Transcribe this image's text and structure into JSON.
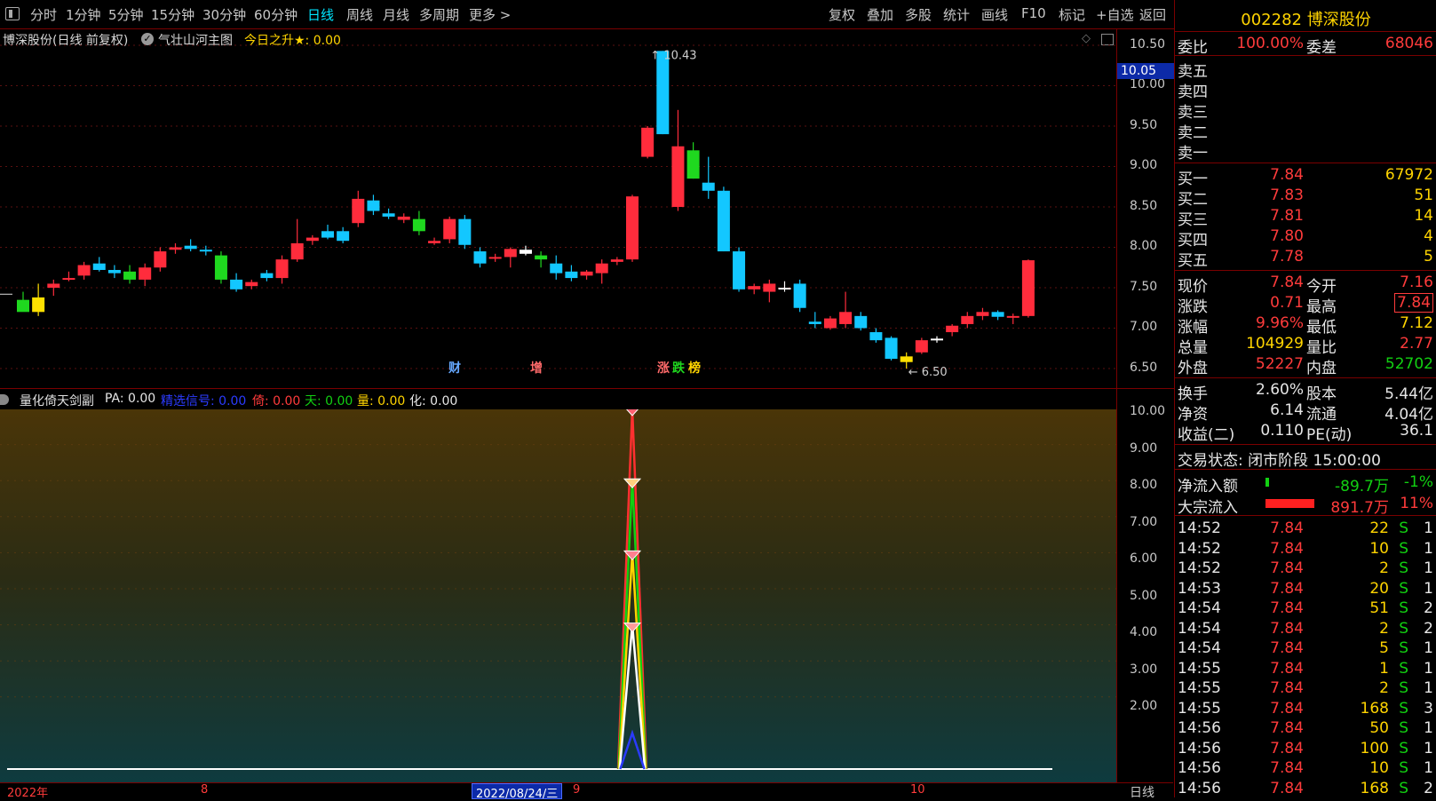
{
  "toolbar": {
    "menu_icon": "menu-icon",
    "periods": [
      "分时",
      "1分钟",
      "5分钟",
      "15分钟",
      "30分钟",
      "60分钟",
      "日线",
      "周线",
      "月线",
      "多周期",
      "更多 >"
    ],
    "active_period": "日线",
    "actions": [
      "复权",
      "叠加",
      "多股",
      "统计",
      "画线",
      "F10",
      "标记",
      "+自选",
      "返回"
    ]
  },
  "main_chart": {
    "title": "博深股份(日线 前复权)",
    "indicator": "气壮山河主图",
    "rise_label": "今日之升★: 0.00",
    "price_high": "10.43",
    "price_low": "← 6.50",
    "current_price_tag": "10.05",
    "y_axis": [
      "10.50",
      "10.00",
      "9.50",
      "9.00",
      "8.50",
      "8.00",
      "7.50",
      "7.00",
      "6.50"
    ],
    "markers": {
      "cai": "财",
      "zeng": "增",
      "zhang": "涨",
      "die": "跌",
      "bang": "榜"
    },
    "colors": {
      "up": "#ff2c3c",
      "down": "#13c7ff",
      "flat": "#ffffff",
      "green": "#1fd81f",
      "yellow": "#ffe000"
    },
    "candles": [
      {
        "o": 7.35,
        "h": 7.45,
        "l": 7.25,
        "c": 7.2,
        "col": "green"
      },
      {
        "o": 7.2,
        "h": 7.55,
        "l": 7.15,
        "c": 7.38,
        "col": "yellow"
      },
      {
        "o": 7.5,
        "h": 7.6,
        "l": 7.4,
        "c": 7.55,
        "col": "up"
      },
      {
        "o": 7.62,
        "h": 7.7,
        "l": 7.58,
        "c": 7.62,
        "col": "up"
      },
      {
        "o": 7.65,
        "h": 7.82,
        "l": 7.6,
        "c": 7.78,
        "col": "up"
      },
      {
        "o": 7.8,
        "h": 7.88,
        "l": 7.7,
        "c": 7.72,
        "col": "down"
      },
      {
        "o": 7.72,
        "h": 7.78,
        "l": 7.62,
        "c": 7.68,
        "col": "down"
      },
      {
        "o": 7.7,
        "h": 7.78,
        "l": 7.55,
        "c": 7.6,
        "col": "green"
      },
      {
        "o": 7.6,
        "h": 7.8,
        "l": 7.52,
        "c": 7.75,
        "col": "up"
      },
      {
        "o": 7.75,
        "h": 8.0,
        "l": 7.7,
        "c": 7.95,
        "col": "up"
      },
      {
        "o": 7.97,
        "h": 8.05,
        "l": 7.92,
        "c": 8.0,
        "col": "up"
      },
      {
        "o": 8.02,
        "h": 8.1,
        "l": 7.95,
        "c": 7.98,
        "col": "down"
      },
      {
        "o": 7.97,
        "h": 8.02,
        "l": 7.9,
        "c": 7.96,
        "col": "down"
      },
      {
        "o": 7.9,
        "h": 7.95,
        "l": 7.55,
        "c": 7.6,
        "col": "green"
      },
      {
        "o": 7.6,
        "h": 7.68,
        "l": 7.45,
        "c": 7.48,
        "col": "down"
      },
      {
        "o": 7.52,
        "h": 7.6,
        "l": 7.48,
        "c": 7.57,
        "col": "up"
      },
      {
        "o": 7.62,
        "h": 7.72,
        "l": 7.58,
        "c": 7.68,
        "col": "down"
      },
      {
        "o": 7.62,
        "h": 7.9,
        "l": 7.55,
        "c": 7.85,
        "col": "up"
      },
      {
        "o": 7.85,
        "h": 8.35,
        "l": 7.82,
        "c": 8.05,
        "col": "up"
      },
      {
        "o": 8.08,
        "h": 8.15,
        "l": 8.03,
        "c": 8.12,
        "col": "up"
      },
      {
        "o": 8.2,
        "h": 8.28,
        "l": 8.1,
        "c": 8.12,
        "col": "down"
      },
      {
        "o": 8.2,
        "h": 8.25,
        "l": 8.05,
        "c": 8.08,
        "col": "down"
      },
      {
        "o": 8.3,
        "h": 8.7,
        "l": 8.25,
        "c": 8.6,
        "col": "up"
      },
      {
        "o": 8.58,
        "h": 8.65,
        "l": 8.4,
        "c": 8.45,
        "col": "down"
      },
      {
        "o": 8.42,
        "h": 8.48,
        "l": 8.35,
        "c": 8.38,
        "col": "down"
      },
      {
        "o": 8.38,
        "h": 8.42,
        "l": 8.3,
        "c": 8.34,
        "col": "up"
      },
      {
        "o": 8.35,
        "h": 8.45,
        "l": 8.15,
        "c": 8.2,
        "col": "green"
      },
      {
        "o": 8.05,
        "h": 8.12,
        "l": 8.03,
        "c": 8.08,
        "col": "up"
      },
      {
        "o": 8.1,
        "h": 8.38,
        "l": 8.05,
        "c": 8.35,
        "col": "up"
      },
      {
        "o": 8.35,
        "h": 8.4,
        "l": 7.98,
        "c": 8.03,
        "col": "down"
      },
      {
        "o": 7.95,
        "h": 8.0,
        "l": 7.75,
        "c": 7.8,
        "col": "down"
      },
      {
        "o": 7.88,
        "h": 7.92,
        "l": 7.82,
        "c": 7.86,
        "col": "up"
      },
      {
        "o": 7.88,
        "h": 8.0,
        "l": 7.75,
        "c": 7.98,
        "col": "up"
      },
      {
        "o": 7.97,
        "h": 8.02,
        "l": 7.9,
        "c": 7.92,
        "col": "flat"
      },
      {
        "o": 7.85,
        "h": 7.95,
        "l": 7.75,
        "c": 7.9,
        "col": "green"
      },
      {
        "o": 7.8,
        "h": 7.9,
        "l": 7.6,
        "c": 7.68,
        "col": "down"
      },
      {
        "o": 7.7,
        "h": 7.78,
        "l": 7.58,
        "c": 7.62,
        "col": "down"
      },
      {
        "o": 7.65,
        "h": 7.72,
        "l": 7.6,
        "c": 7.7,
        "col": "up"
      },
      {
        "o": 7.68,
        "h": 7.85,
        "l": 7.55,
        "c": 7.8,
        "col": "up"
      },
      {
        "o": 7.82,
        "h": 7.88,
        "l": 7.78,
        "c": 7.85,
        "col": "up"
      },
      {
        "o": 7.85,
        "h": 8.65,
        "l": 7.82,
        "c": 8.63,
        "col": "up"
      },
      {
        "o": 9.12,
        "h": 9.5,
        "l": 9.1,
        "c": 9.48,
        "col": "up"
      },
      {
        "o": 10.43,
        "h": 10.43,
        "l": 9.4,
        "c": 9.4,
        "col": "down"
      },
      {
        "o": 8.5,
        "h": 9.7,
        "l": 8.45,
        "c": 9.25,
        "col": "up"
      },
      {
        "o": 9.2,
        "h": 9.3,
        "l": 8.85,
        "c": 8.85,
        "col": "green"
      },
      {
        "o": 8.8,
        "h": 9.12,
        "l": 8.6,
        "c": 8.7,
        "col": "down"
      },
      {
        "o": 8.7,
        "h": 8.75,
        "l": 7.95,
        "c": 7.95,
        "col": "down"
      },
      {
        "o": 7.95,
        "h": 8.0,
        "l": 7.45,
        "c": 7.48,
        "col": "down"
      },
      {
        "o": 7.48,
        "h": 7.55,
        "l": 7.42,
        "c": 7.52,
        "col": "up"
      },
      {
        "o": 7.45,
        "h": 7.6,
        "l": 7.32,
        "c": 7.55,
        "col": "up"
      },
      {
        "o": 7.5,
        "h": 7.58,
        "l": 7.45,
        "c": 7.48,
        "col": "flat"
      },
      {
        "o": 7.55,
        "h": 7.6,
        "l": 7.2,
        "c": 7.25,
        "col": "down"
      },
      {
        "o": 7.08,
        "h": 7.2,
        "l": 7.0,
        "c": 7.05,
        "col": "down"
      },
      {
        "o": 7.0,
        "h": 7.15,
        "l": 6.98,
        "c": 7.12,
        "col": "up"
      },
      {
        "o": 7.05,
        "h": 7.45,
        "l": 7.0,
        "c": 7.2,
        "col": "up"
      },
      {
        "o": 7.15,
        "h": 7.2,
        "l": 6.97,
        "c": 7.0,
        "col": "down"
      },
      {
        "o": 6.95,
        "h": 7.0,
        "l": 6.82,
        "c": 6.85,
        "col": "down"
      },
      {
        "o": 6.88,
        "h": 6.9,
        "l": 6.6,
        "c": 6.62,
        "col": "down"
      },
      {
        "o": 6.58,
        "h": 6.7,
        "l": 6.5,
        "c": 6.65,
        "col": "yellow"
      },
      {
        "o": 6.7,
        "h": 6.88,
        "l": 6.68,
        "c": 6.85,
        "col": "up"
      },
      {
        "o": 6.85,
        "h": 6.9,
        "l": 6.82,
        "c": 6.87,
        "col": "flat"
      },
      {
        "o": 6.95,
        "h": 7.05,
        "l": 6.9,
        "c": 7.03,
        "col": "up"
      },
      {
        "o": 7.05,
        "h": 7.2,
        "l": 7.0,
        "c": 7.15,
        "col": "up"
      },
      {
        "o": 7.15,
        "h": 7.25,
        "l": 7.1,
        "c": 7.2,
        "col": "up"
      },
      {
        "o": 7.2,
        "h": 7.22,
        "l": 7.1,
        "c": 7.14,
        "col": "down"
      },
      {
        "o": 7.13,
        "h": 7.18,
        "l": 7.05,
        "c": 7.15,
        "col": "up"
      },
      {
        "o": 7.15,
        "h": 7.85,
        "l": 7.13,
        "c": 7.84,
        "col": "up"
      }
    ]
  },
  "sub_chart": {
    "title": "量化倚天剑副",
    "params": [
      {
        "label": "PA: 0.00",
        "color": "#e6e6e6"
      },
      {
        "label": "精选信号: 0.00",
        "color": "#2b3bff"
      },
      {
        "label": "倚: 0.00",
        "color": "#ff3b3b"
      },
      {
        "label": "天: 0.00",
        "color": "#12d012"
      },
      {
        "label": "量: 0.00",
        "color": "#ffd400"
      },
      {
        "label": "化: 0.00",
        "color": "#e6e6e6"
      }
    ],
    "y_axis": [
      "10.00",
      "9.00",
      "8.00",
      "7.00",
      "6.00",
      "5.00",
      "4.00",
      "3.00",
      "2.00"
    ],
    "spike_lines": [
      {
        "name": "倚",
        "peak": 10.0,
        "color": "#ff3030"
      },
      {
        "name": "天",
        "peak": 8.0,
        "color": "#12d012"
      },
      {
        "name": "量",
        "peak": 6.0,
        "color": "#ffd400"
      },
      {
        "name": "化",
        "peak": 4.0,
        "color": "#ffffff"
      },
      {
        "name": "精选信号",
        "peak": 1.0,
        "color": "#2b3bff"
      }
    ]
  },
  "x_axis": {
    "year": "2022年",
    "m8": "8",
    "selected_date": "2022/08/24/三",
    "m9": "9",
    "m10": "10",
    "period": "日线"
  },
  "quote": {
    "code_name": "002282 博深股份",
    "weibi_label": "委比",
    "weibi_value": "100.00%",
    "weicha_label": "委差",
    "weicha_value": "68046",
    "asks": [
      {
        "label": "卖五",
        "price": "",
        "vol": ""
      },
      {
        "label": "卖四",
        "price": "",
        "vol": ""
      },
      {
        "label": "卖三",
        "price": "",
        "vol": ""
      },
      {
        "label": "卖二",
        "price": "",
        "vol": ""
      },
      {
        "label": "卖一",
        "price": "",
        "vol": ""
      }
    ],
    "bids": [
      {
        "label": "买一",
        "price": "7.84",
        "vol": "67972"
      },
      {
        "label": "买二",
        "price": "7.83",
        "vol": "51"
      },
      {
        "label": "买三",
        "price": "7.81",
        "vol": "14"
      },
      {
        "label": "买四",
        "price": "7.80",
        "vol": "4"
      },
      {
        "label": "买五",
        "price": "7.78",
        "vol": "5"
      }
    ],
    "stats": [
      {
        "l1": "现价",
        "v1": "7.84",
        "c1": "red",
        "l2": "今开",
        "v2": "7.16",
        "c2": "red"
      },
      {
        "l1": "涨跌",
        "v1": "0.71",
        "c1": "red",
        "l2": "最高",
        "v2": "7.84",
        "c2": "red"
      },
      {
        "l1": "涨幅",
        "v1": "9.96%",
        "c1": "red",
        "l2": "最低",
        "v2": "7.12",
        "c2": "yellow"
      },
      {
        "l1": "总量",
        "v1": "104929",
        "c1": "yellow",
        "l2": "量比",
        "v2": "2.77",
        "c2": "red"
      },
      {
        "l1": "外盘",
        "v1": "52227",
        "c1": "red",
        "l2": "内盘",
        "v2": "52702",
        "c2": "green"
      }
    ],
    "stats2": [
      {
        "l1": "换手",
        "v1": "2.60%",
        "l2": "股本",
        "v2": "5.44亿"
      },
      {
        "l1": "净资",
        "v1": "6.14",
        "l2": "流通",
        "v2": "4.04亿"
      },
      {
        "l1": "收益(二)",
        "v1": "0.110",
        "l2": "PE(动)",
        "v2": "36.1"
      }
    ],
    "trade_state": "交易状态: 闭市阶段 15:00:00",
    "net_inflow_label": "净流入额",
    "net_inflow_value": "-89.7万",
    "net_inflow_pct": "-1%",
    "block_inflow_label": "大宗流入",
    "block_inflow_value": "891.7万",
    "block_inflow_pct": "11%",
    "ticks": [
      {
        "time": "14:52",
        "price": "7.84",
        "vol": "22",
        "side": "S",
        "n": "1"
      },
      {
        "time": "14:52",
        "price": "7.84",
        "vol": "10",
        "side": "S",
        "n": "1"
      },
      {
        "time": "14:52",
        "price": "7.84",
        "vol": "2",
        "side": "S",
        "n": "1"
      },
      {
        "time": "14:53",
        "price": "7.84",
        "vol": "20",
        "side": "S",
        "n": "1"
      },
      {
        "time": "14:54",
        "price": "7.84",
        "vol": "51",
        "side": "S",
        "n": "2"
      },
      {
        "time": "14:54",
        "price": "7.84",
        "vol": "2",
        "side": "S",
        "n": "2"
      },
      {
        "time": "14:54",
        "price": "7.84",
        "vol": "5",
        "side": "S",
        "n": "1"
      },
      {
        "time": "14:55",
        "price": "7.84",
        "vol": "1",
        "side": "S",
        "n": "1"
      },
      {
        "time": "14:55",
        "price": "7.84",
        "vol": "2",
        "side": "S",
        "n": "1"
      },
      {
        "time": "14:55",
        "price": "7.84",
        "vol": "168",
        "side": "S",
        "n": "3"
      },
      {
        "time": "14:56",
        "price": "7.84",
        "vol": "50",
        "side": "S",
        "n": "1"
      },
      {
        "time": "14:56",
        "price": "7.84",
        "vol": "100",
        "side": "S",
        "n": "1"
      },
      {
        "time": "14:56",
        "price": "7.84",
        "vol": "10",
        "side": "S",
        "n": "1"
      },
      {
        "time": "14:56",
        "price": "7.84",
        "vol": "168",
        "side": "S",
        "n": "2"
      }
    ]
  }
}
